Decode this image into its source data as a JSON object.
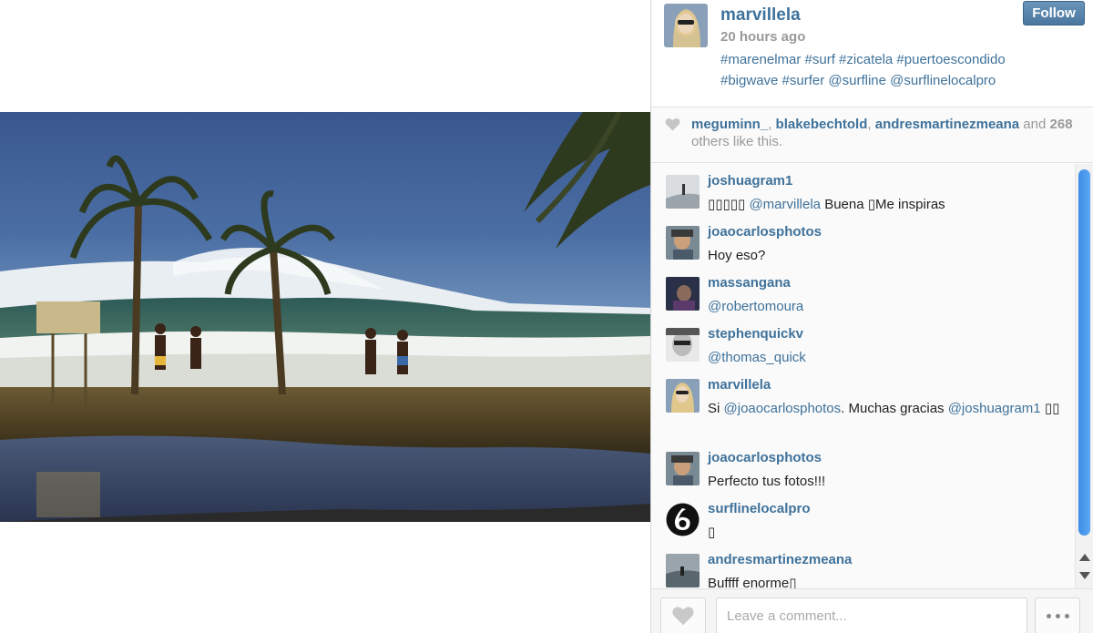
{
  "post": {
    "owner": "marvillela",
    "time": "20 hours ago",
    "caption": "#marenelmar #surf #zicatela #puertoescondido #bigwave #surfer @surfline @surflinelocalpro",
    "follow_label": "Follow"
  },
  "likes": {
    "user1": "meguminn_",
    "sep1": ", ",
    "user2": "blakebechtold",
    "sep2": ", ",
    "user3": "andresmartinezmeana",
    "and_text": " and ",
    "count": "268",
    "others_text": " others like this."
  },
  "comments": [
    {
      "user": "joshuagram1",
      "pre": "▯▯▯▯▯ ",
      "mention": "@marvillela",
      "post": " Buena ▯Me inspiras"
    },
    {
      "user": "joaocarlosphotos",
      "pre": "Hoy eso?",
      "mention": "",
      "post": ""
    },
    {
      "user": "massangana",
      "pre": "",
      "mention": "@robertomoura",
      "post": ""
    },
    {
      "user": "stephenquickv",
      "pre": "",
      "mention": "@thomas_quick",
      "post": ""
    },
    {
      "user": "marvillela",
      "pre": "Si ",
      "mention": "@joaocarlosphotos",
      "post": ". Muchas gracias ",
      "mention2": "@joshuagram1",
      "post2": " ▯▯"
    },
    {
      "user": "joaocarlosphotos",
      "pre": "Perfecto tus fotos!!!",
      "mention": "",
      "post": ""
    },
    {
      "user": "surflinelocalpro",
      "pre": "▯",
      "mention": "",
      "post": ""
    },
    {
      "user": "andresmartinezmeana",
      "pre": "Buffff enorme▯",
      "mention": "",
      "post": ""
    }
  ],
  "comment_box": {
    "placeholder": "Leave a comment..."
  },
  "icons": {
    "heart": "heart-icon",
    "more": "more-options-icon"
  },
  "colors": {
    "link": "#3f729b",
    "follow_button": "#517fa4",
    "scrollbar": "#4a98ec"
  }
}
